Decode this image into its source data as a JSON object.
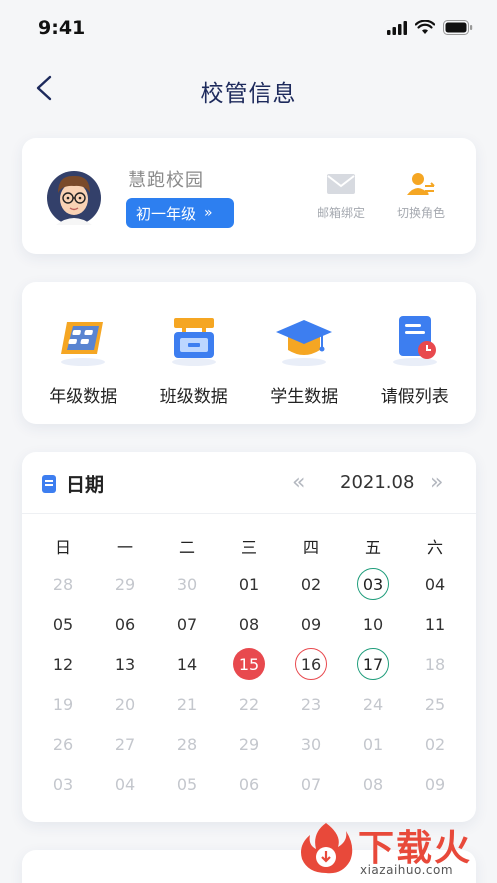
{
  "status_bar": {
    "time": "9:41"
  },
  "nav": {
    "title": "校管信息"
  },
  "profile": {
    "school_name": "慧跑校园",
    "grade_label": "初一年级",
    "grade_chevron": "»",
    "actions": [
      {
        "label": "邮箱绑定",
        "icon": "mail-icon"
      },
      {
        "label": "切换角色",
        "icon": "switch-user-icon"
      }
    ]
  },
  "menu": {
    "items": [
      {
        "label": "年级数据",
        "icon": "grade-data-icon"
      },
      {
        "label": "班级数据",
        "icon": "class-data-icon"
      },
      {
        "label": "学生数据",
        "icon": "graduation-cap-icon"
      },
      {
        "label": "请假列表",
        "icon": "leave-list-icon"
      }
    ]
  },
  "calendar": {
    "title": "日期",
    "prev": "«",
    "month": "2021.08",
    "next": "»",
    "weekdays": [
      "日",
      "一",
      "二",
      "三",
      "四",
      "五",
      "六"
    ],
    "rows": [
      [
        {
          "d": "28",
          "s": "muted"
        },
        {
          "d": "29",
          "s": "muted"
        },
        {
          "d": "30",
          "s": "muted"
        },
        {
          "d": "01",
          "s": "normal"
        },
        {
          "d": "02",
          "s": "normal"
        },
        {
          "d": "03",
          "s": "green-ring"
        },
        {
          "d": "04",
          "s": "normal"
        }
      ],
      [
        {
          "d": "05",
          "s": "normal"
        },
        {
          "d": "06",
          "s": "normal"
        },
        {
          "d": "07",
          "s": "normal"
        },
        {
          "d": "08",
          "s": "normal"
        },
        {
          "d": "09",
          "s": "normal"
        },
        {
          "d": "10",
          "s": "normal"
        },
        {
          "d": "11",
          "s": "normal"
        }
      ],
      [
        {
          "d": "12",
          "s": "normal"
        },
        {
          "d": "13",
          "s": "normal"
        },
        {
          "d": "14",
          "s": "normal"
        },
        {
          "d": "15",
          "s": "today"
        },
        {
          "d": "16",
          "s": "red-ring"
        },
        {
          "d": "17",
          "s": "green-ring"
        },
        {
          "d": "18",
          "s": "muted"
        }
      ],
      [
        {
          "d": "19",
          "s": "muted"
        },
        {
          "d": "20",
          "s": "muted"
        },
        {
          "d": "21",
          "s": "muted"
        },
        {
          "d": "22",
          "s": "muted"
        },
        {
          "d": "23",
          "s": "muted"
        },
        {
          "d": "24",
          "s": "muted"
        },
        {
          "d": "25",
          "s": "muted"
        }
      ],
      [
        {
          "d": "26",
          "s": "muted"
        },
        {
          "d": "27",
          "s": "muted"
        },
        {
          "d": "28",
          "s": "muted"
        },
        {
          "d": "29",
          "s": "muted"
        },
        {
          "d": "30",
          "s": "muted"
        },
        {
          "d": "01",
          "s": "muted"
        },
        {
          "d": "02",
          "s": "muted"
        }
      ],
      [
        {
          "d": "03",
          "s": "muted"
        },
        {
          "d": "04",
          "s": "muted"
        },
        {
          "d": "05",
          "s": "muted"
        },
        {
          "d": "06",
          "s": "muted"
        },
        {
          "d": "07",
          "s": "muted"
        },
        {
          "d": "08",
          "s": "muted"
        },
        {
          "d": "09",
          "s": "muted"
        }
      ]
    ]
  },
  "watermark": {
    "text": "下载火",
    "url": "xiazaihuo.com"
  },
  "colors": {
    "accent": "#2d7ff0",
    "today": "#e8494e",
    "ring_green": "#1f9d7b",
    "title": "#1d2a5c"
  }
}
